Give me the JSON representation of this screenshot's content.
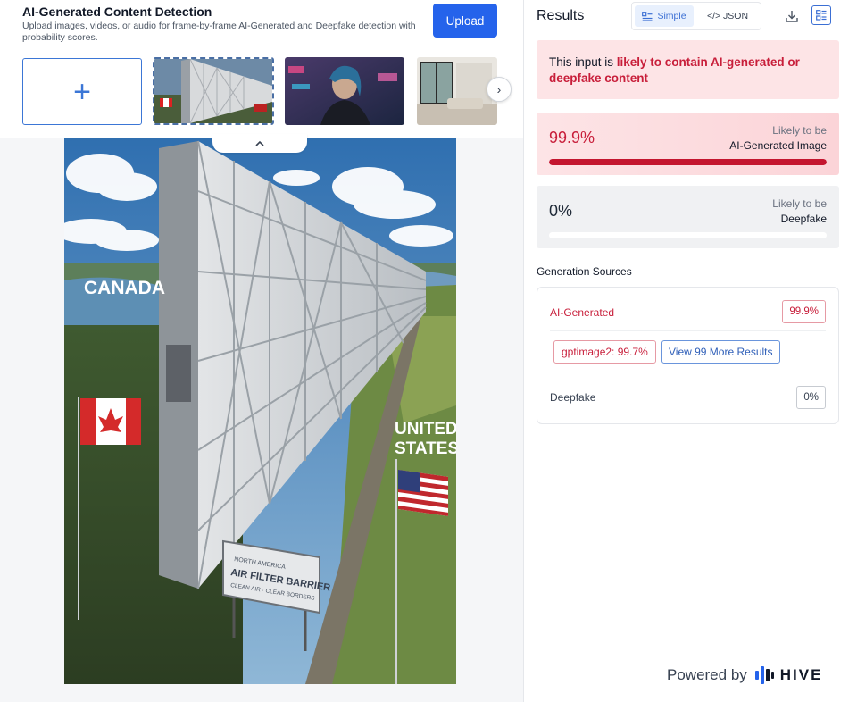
{
  "header": {
    "title": "AI-Generated Content Detection",
    "description": "Upload images, videos, or audio for frame-by-frame AI-Generated and Deepfake detection with probability scores.",
    "upload_label": "Upload"
  },
  "thumbnails": {
    "add_symbol": "+",
    "next_symbol": "›",
    "collapse_symbol": "^",
    "items": [
      {
        "name": "wall-border-image",
        "selected": true
      },
      {
        "name": "cyber-woman-image",
        "selected": false
      },
      {
        "name": "interior-room-image",
        "selected": false
      }
    ]
  },
  "preview": {
    "left_country": "CANADA",
    "right_country_line1": "UNITED",
    "right_country_line2": "STATES",
    "billboard_line1": "NORTH AMERICA",
    "billboard_line2": "AIR FILTER BARRIER",
    "billboard_line3": "CLEAN AIR · CLEAR BORDERS"
  },
  "results": {
    "title": "Results",
    "view_simple": "Simple",
    "view_json": "</> JSON",
    "verdict_prefix": "This input is ",
    "verdict_highlight": "likely to contain AI-generated or deepfake content",
    "ai": {
      "value": "99.9%",
      "fraction": 0.999,
      "label_top": "Likely to be",
      "label_bottom": "AI-Generated Image"
    },
    "deepfake": {
      "value": "0%",
      "fraction": 0.0,
      "label_top": "Likely to be",
      "label_bottom": "Deepfake"
    },
    "sources_title": "Generation Sources",
    "sources": {
      "ai_label": "AI-Generated",
      "ai_value": "99.9%",
      "model_chip": "gptimage2: 99.7%",
      "more_button": "View 99 More Results",
      "df_label": "Deepfake",
      "df_value": "0%"
    },
    "powered_by": "Powered by",
    "brand": "HIVE"
  },
  "colors": {
    "accent_blue": "#2563eb",
    "alert_red": "#c81e3a",
    "verdict_bg": "#fde4e6"
  }
}
